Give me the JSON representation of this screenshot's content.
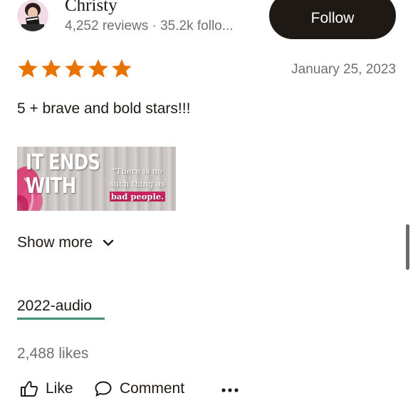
{
  "reviewer": {
    "name": "Christy",
    "meta": "4,252 reviews · 35.2k follo...",
    "follow_label": "Follow",
    "avatar_icon": "avatar-reader-photo"
  },
  "review": {
    "rating": 5,
    "max_rating": 5,
    "star_color": "#e87400",
    "date": "January 25, 2023",
    "text": "5 + brave and bold stars!!!",
    "image": {
      "title_line1": "IT ENDS",
      "title_line2": "WITH",
      "quote_line1": "\"There is no",
      "quote_line2": "such thing as",
      "quote_highlight": "bad people."
    },
    "show_more_label": "Show more",
    "shelf_tag": "2022-audio",
    "tag_underline_color": "#3f9270",
    "likes": "2,488 likes"
  },
  "actions": {
    "like_label": "Like",
    "comment_label": "Comment",
    "more_icon": "ellipsis-icon"
  }
}
